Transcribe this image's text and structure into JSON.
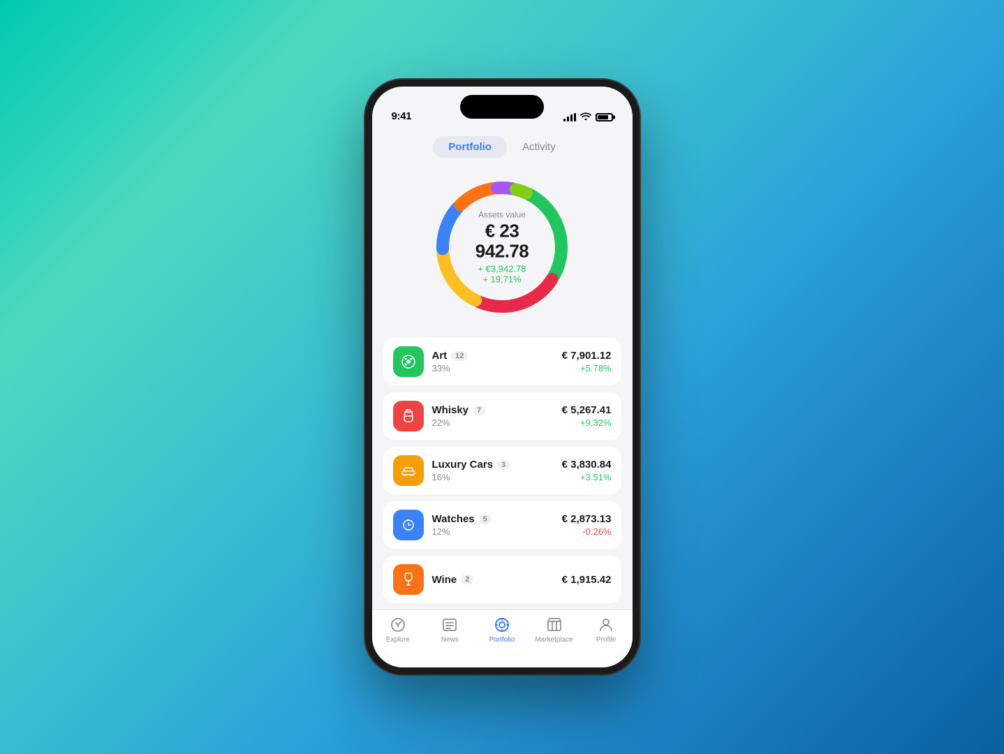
{
  "background": {
    "gradient": "teal-to-blue"
  },
  "statusBar": {
    "time": "9:41"
  },
  "tabs": {
    "items": [
      {
        "id": "portfolio",
        "label": "Portfolio",
        "active": true
      },
      {
        "id": "activity",
        "label": "Activity",
        "active": false
      }
    ]
  },
  "chart": {
    "assetsLabel": "Assets value",
    "assetsValue": "€ 23 942.78",
    "gain": "+ €3,942.78",
    "gainPct": "+ 19.71%",
    "segments": [
      {
        "id": "art",
        "color": "#22c55e",
        "pct": 33,
        "dashoffset": 120
      },
      {
        "id": "whisky",
        "color": "#ef4444",
        "pct": 22,
        "dashoffset": 220
      },
      {
        "id": "cars",
        "color": "#f59e0b",
        "pct": 16,
        "dashoffset": 310
      },
      {
        "id": "watches",
        "color": "#3b82f6",
        "pct": 12,
        "dashoffset": 390
      },
      {
        "id": "wine",
        "color": "#f97316",
        "pct": 10,
        "dashoffset": 450
      },
      {
        "id": "other1",
        "color": "#a855f7",
        "pct": 4,
        "dashoffset": 500
      },
      {
        "id": "other2",
        "color": "#84cc16",
        "pct": 3,
        "dashoffset": 530
      }
    ]
  },
  "assets": [
    {
      "id": "art",
      "name": "Art",
      "count": "12",
      "pct": "33%",
      "amount": "€ 7,901.12",
      "change": "+5.78%",
      "positive": true,
      "iconType": "art"
    },
    {
      "id": "whisky",
      "name": "Whisky",
      "count": "7",
      "pct": "22%",
      "amount": "€ 5,267.41",
      "change": "+9.32%",
      "positive": true,
      "iconType": "whisky"
    },
    {
      "id": "cars",
      "name": "Luxury Cars",
      "count": "3",
      "pct": "16%",
      "amount": "€ 3,830.84",
      "change": "+3.51%",
      "positive": true,
      "iconType": "cars"
    },
    {
      "id": "watches",
      "name": "Watches",
      "count": "5",
      "pct": "12%",
      "amount": "€ 2,873.13",
      "change": "-0.26%",
      "positive": false,
      "iconType": "watches"
    },
    {
      "id": "wine",
      "name": "Wine",
      "count": "2",
      "pct": "",
      "amount": "€ 1,915.42",
      "change": "",
      "positive": true,
      "iconType": "wine"
    }
  ],
  "bottomNav": {
    "items": [
      {
        "id": "explore",
        "label": "Explore",
        "active": false
      },
      {
        "id": "news",
        "label": "News",
        "active": false
      },
      {
        "id": "portfolio",
        "label": "Portfolio",
        "active": true
      },
      {
        "id": "marketplace",
        "label": "Marketplace",
        "active": false
      },
      {
        "id": "profile",
        "label": "Profile",
        "active": false
      }
    ]
  }
}
